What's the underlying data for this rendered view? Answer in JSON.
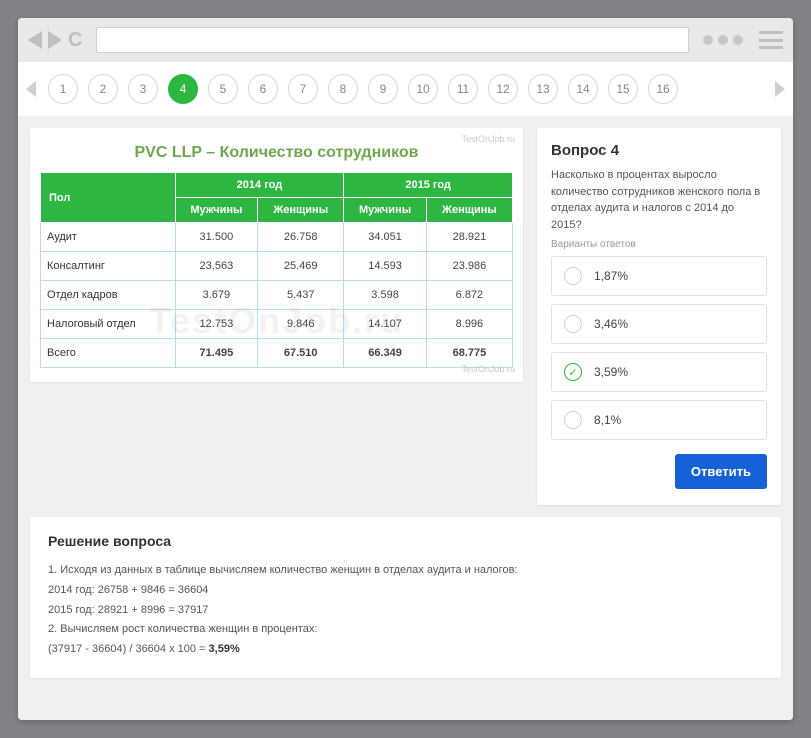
{
  "browser": {
    "back": "back",
    "forward": "forward",
    "reload": "reload"
  },
  "pager": {
    "current": 4,
    "pages": [
      1,
      2,
      3,
      4,
      5,
      6,
      7,
      8,
      9,
      10,
      11,
      12,
      13,
      14,
      15,
      16
    ]
  },
  "watermark": {
    "small": "TestOnJob.ru",
    "big": "TestOnJob.ru"
  },
  "table": {
    "title": "PVC LLP – Количество сотрудников",
    "year1": "2014 год",
    "year2": "2015 год",
    "col_label": "Пол",
    "col_m": "Мужчины",
    "col_w": "Женщины",
    "rows": [
      {
        "label": "Аудит",
        "m1": "31.500",
        "w1": "26.758",
        "m2": "34.051",
        "w2": "28.921"
      },
      {
        "label": "Консалтинг",
        "m1": "23.563",
        "w1": "25.469",
        "m2": "14.593",
        "w2": "23.986"
      },
      {
        "label": "Отдел кадров",
        "m1": "3.679",
        "w1": "5.437",
        "m2": "3.598",
        "w2": "6.872"
      },
      {
        "label": "Налоговый отдел",
        "m1": "12.753",
        "w1": "9.846",
        "m2": "14.107",
        "w2": "8.996"
      }
    ],
    "total": {
      "label": "Всего",
      "m1": "71.495",
      "w1": "67.510",
      "m2": "66.349",
      "w2": "68.775"
    }
  },
  "question": {
    "title": "Вопрос 4",
    "text": "Насколько в процентах выросло количество сотрудников женского пола в отделах аудита и налогов с 2014 до 2015?",
    "variants_label": "Варианты ответов",
    "options": [
      {
        "label": "1,87%",
        "selected": false
      },
      {
        "label": "3,46%",
        "selected": false
      },
      {
        "label": "3,59%",
        "selected": true
      },
      {
        "label": "8,1%",
        "selected": false
      }
    ],
    "answer_button": "Ответить"
  },
  "solution": {
    "title": "Решение вопроса",
    "line1": "1. Исходя из данных в таблице вычисляем количество женщин в отделах аудита и налогов:",
    "line2": "2014 год: 26758 + 9846 = 36604",
    "line3": "2015 год: 28921 + 8996 = 37917",
    "line4": "2. Вычисляем рост количества женщин в процентах:",
    "line5_prefix": "(37917 - 36604) / 36604 x 100 = ",
    "line5_bold": "3,59%"
  }
}
